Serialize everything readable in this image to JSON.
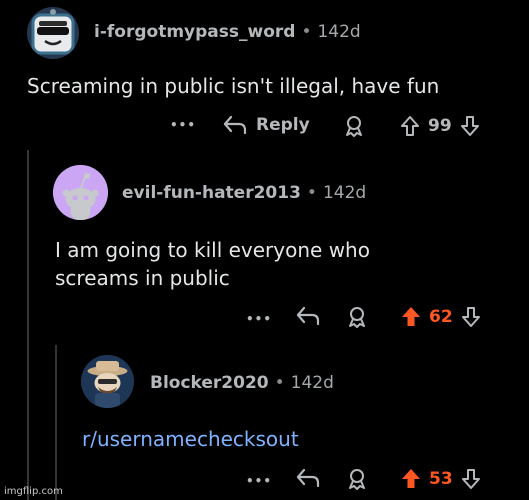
{
  "comments": [
    {
      "username": "i-forgotmypass_word",
      "separator": "•",
      "age": "142d",
      "body": "Screaming in public isn't illegal, have fun",
      "actions": {
        "more": "•••",
        "reply": "Reply",
        "votes": "99"
      }
    },
    {
      "username": "evil-fun-hater2013",
      "separator": "•",
      "age": "142d",
      "body_line1": "I am going to kill everyone who",
      "body_line2": "screams in public",
      "actions": {
        "more": "•••",
        "votes": "62"
      }
    },
    {
      "username": "Blocker2020",
      "separator": "•",
      "age": "142d",
      "body": "r/usernamechecksout",
      "actions": {
        "more": "•••",
        "votes": "53"
      }
    }
  ],
  "watermark": "imgflip.com",
  "colors": {
    "background": "#000000",
    "upvote_active": "#ff5722",
    "link": "#7eb2ff",
    "thread_line": "#343536"
  }
}
